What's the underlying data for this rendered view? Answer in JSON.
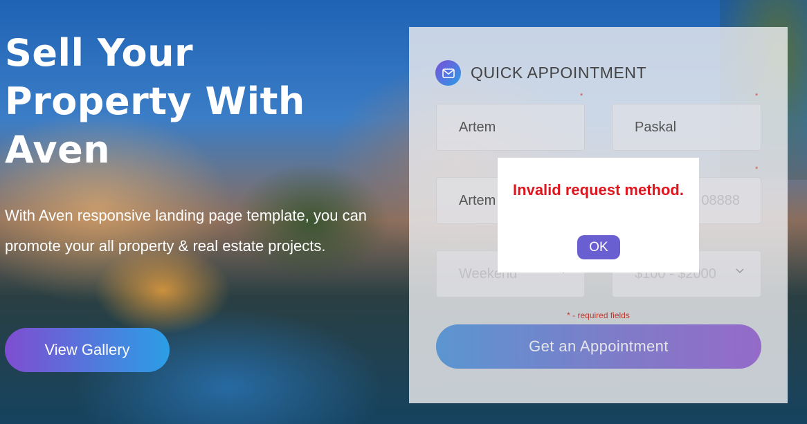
{
  "hero": {
    "title": "Sell Your\nProperty With\nAven",
    "text": "With Aven responsive landing page template, you can promote your all property & real estate projects.",
    "gallery_button": "View Gallery"
  },
  "form": {
    "title": "QUICK APPOINTMENT",
    "icon": "mail-icon",
    "fields": {
      "first_name": "Artem",
      "last_name": "Paskal",
      "email_partial": "Artem",
      "phone_partial": "08888",
      "when": "Weekend",
      "budget": "$100 - $2000"
    },
    "required_mark": "*",
    "required_note": "* - required fields",
    "submit_button": "Get an Appointment"
  },
  "dialog": {
    "message": "Invalid request method.",
    "ok_button": "OK",
    "message_color": "#e0151e"
  },
  "colors": {
    "gradient_purple": "#7f4dd1",
    "gradient_blue": "#2b9ee6",
    "ok_button": "#6a5fd0"
  }
}
